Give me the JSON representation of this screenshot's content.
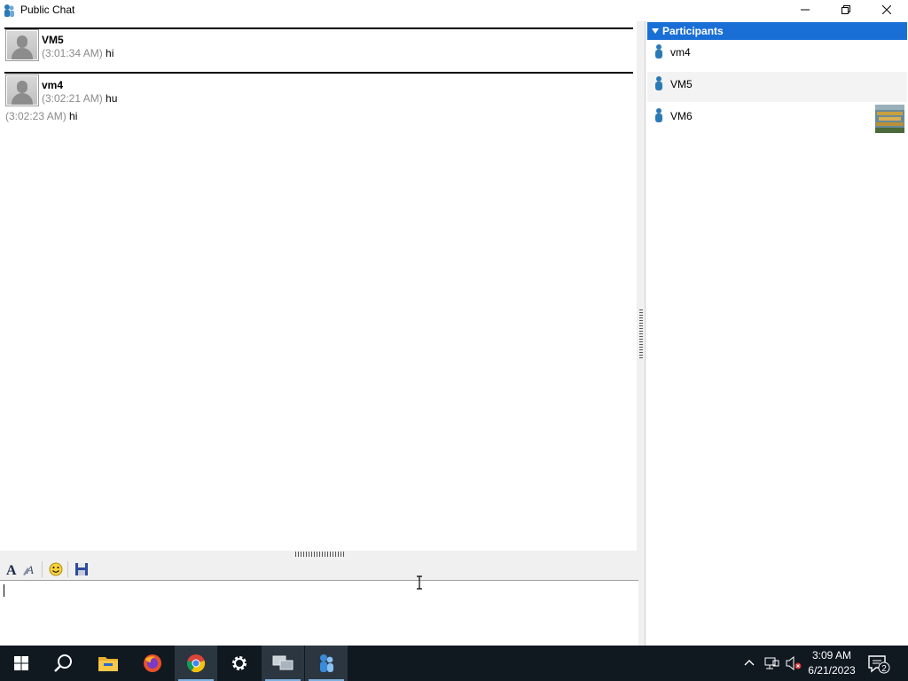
{
  "window": {
    "title": "Public Chat",
    "buttons": {
      "minimize": "minimize",
      "maximize": "restore",
      "close": "close"
    }
  },
  "messages": [
    {
      "name": "VM5",
      "lines": [
        {
          "time": "(3:01:34 AM)",
          "text": "hi"
        }
      ]
    },
    {
      "name": "vm4",
      "lines": [
        {
          "time": "(3:02:21 AM)",
          "text": "hu"
        },
        {
          "time": "(3:02:23 AM)",
          "text": "hi"
        }
      ]
    }
  ],
  "toolbar": {
    "items": [
      "font-icon",
      "font-style-icon",
      "emoticon-icon",
      "save-icon"
    ]
  },
  "input": {
    "value": ""
  },
  "participants": {
    "header": "Participants",
    "items": [
      {
        "name": "vm4"
      },
      {
        "name": "VM5"
      },
      {
        "name": "VM6"
      }
    ]
  },
  "taskbar": {
    "apps": [
      "start-icon",
      "search-icon",
      "file-explorer-icon",
      "firefox-icon",
      "chrome-icon",
      "settings-icon",
      "network-app-icon",
      "chat-app-icon"
    ],
    "clock": {
      "time": "3:09 AM",
      "date": "6/21/2023"
    },
    "notification_count": "2"
  },
  "colors": {
    "accent": "#1a6fd6",
    "taskbar": "#101820",
    "timestamp": "#8a8a8a"
  }
}
